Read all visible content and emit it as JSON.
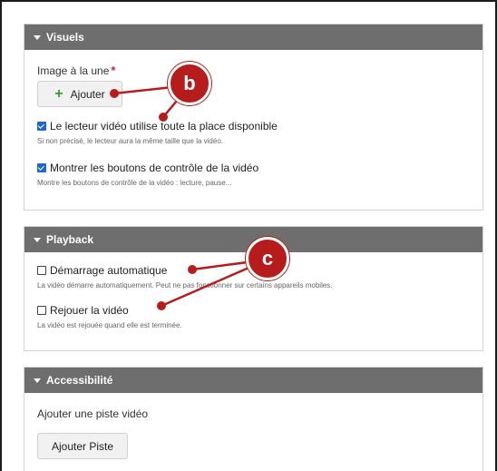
{
  "sections": {
    "visuels": {
      "title": "Visuels",
      "image_label": "Image à la une",
      "required_mark": "*",
      "add_button": "Ajouter",
      "fullwidth": {
        "label": "Le lecteur vidéo utilise toute la place disponible",
        "help": "Si non précisé, le lecteur aura la même taille que la vidéo.",
        "checked": true
      },
      "controls": {
        "label": "Montrer les boutons de contrôle de la vidéo",
        "help": "Montre les boutons de contrôle de la vidéo : lecture, pause...",
        "checked": true
      }
    },
    "playback": {
      "title": "Playback",
      "autoplay": {
        "label": "Démarrage automatique",
        "help": "La vidéo démarre automatiquement. Peut ne pas fonctionner sur certains appareils mobiles.",
        "checked": false
      },
      "loop": {
        "label": "Rejouer la vidéo",
        "help": "La vidéo est rejouée quand elle est terminée.",
        "checked": false
      }
    },
    "accessibilite": {
      "title": "Accessibilité",
      "track_label": "Ajouter une piste vidéo",
      "add_track_button": "Ajouter Piste"
    }
  },
  "callouts": {
    "b": "b",
    "c": "c"
  },
  "colors": {
    "header": "#6e6e6e",
    "callout": "#b71c1c",
    "checkbox": "#1e66d0",
    "plus": "#3a9a3a"
  }
}
